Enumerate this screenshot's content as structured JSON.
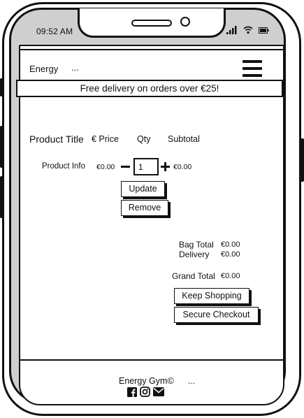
{
  "status_bar": {
    "time": "09:52 AM",
    "icons": [
      "signal-icon",
      "wifi-icon",
      "battery-icon"
    ]
  },
  "header": {
    "brand": "Energy",
    "brand_dots": "...",
    "menu_icon": "hamburger-menu-icon"
  },
  "banner": {
    "text": "Free delivery on orders over €25!"
  },
  "cart": {
    "headers": {
      "product": "Product Title",
      "price": "€ Price",
      "qty": "Qty",
      "subtotal": "Subtotal"
    },
    "row": {
      "info": "Product Info",
      "price": "€0.00",
      "qty": "1",
      "subtotal": "€0.00"
    },
    "update_label": "Update",
    "remove_label": "Remove"
  },
  "totals": {
    "bag_total_label": "Bag Total",
    "bag_total_value": "€0.00",
    "delivery_label": "Delivery",
    "delivery_value": "€0.00",
    "grand_total_label": "Grand Total",
    "grand_total_value": "€0.00"
  },
  "actions": {
    "keep_shopping_label": "Keep Shopping",
    "secure_checkout_label": "Secure Checkout"
  },
  "footer": {
    "brand": "Energy Gym©",
    "dots": "...",
    "icons": [
      "facebook-icon",
      "instagram-icon",
      "email-icon"
    ]
  }
}
